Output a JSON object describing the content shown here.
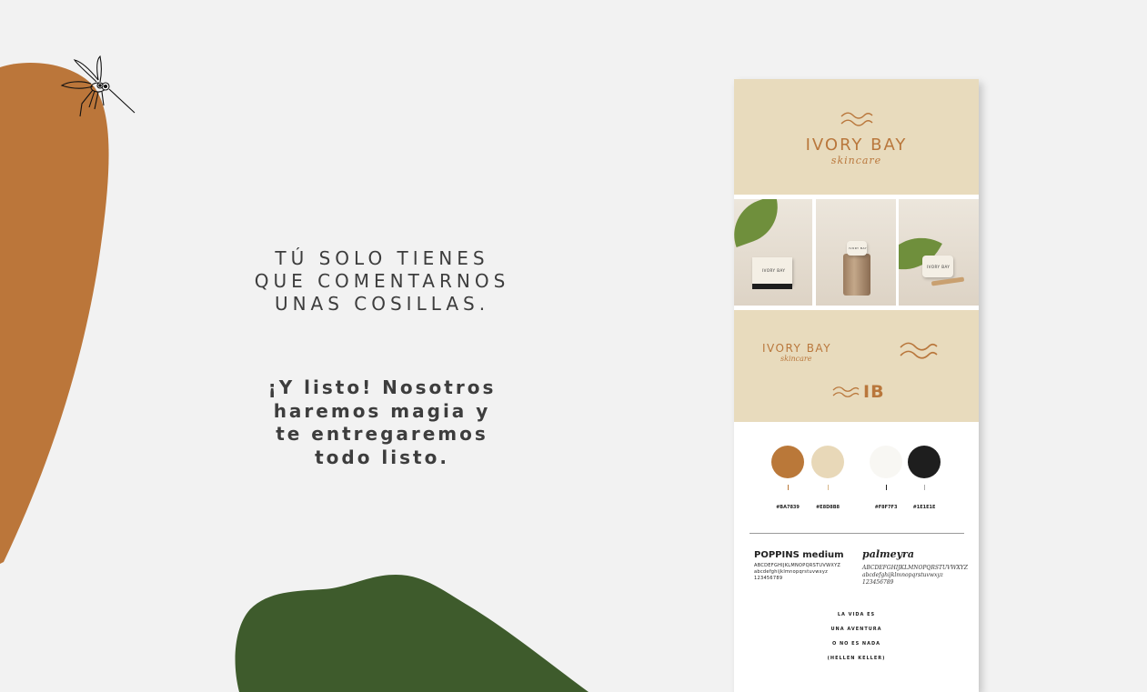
{
  "headline": {
    "lines": [
      "TÚ SOLO TIENES",
      "QUE COMENTARNOS",
      "UNAS COSILLAS."
    ]
  },
  "subtext": {
    "lines": [
      "¡Y listo! Nosotros",
      "haremos magia y",
      "te entregaremos",
      "todo listo."
    ]
  },
  "brand_board": {
    "brand_name": "IVORY BAY",
    "tagline": "skincare",
    "photo_labels": [
      "IVORY BAY",
      "IVORY BAY",
      "IVORY BAY"
    ],
    "monogram": "IB",
    "palette": [
      {
        "hex_label": "#BA7839",
        "color": "#ba7839"
      },
      {
        "hex_label": "#E8D8B8",
        "color": "#e8d8b8"
      },
      {
        "hex_label": "#F8F7F3",
        "color": "#f8f7f3"
      },
      {
        "hex_label": "#1E1E1E",
        "color": "#1e1e1e"
      }
    ],
    "fonts": {
      "primary_name": "POPPINS medium",
      "primary_upper": "ABCDEFGHIJKLMNOPQRSTUVWXYZ",
      "primary_lower": "abcdefghijklmnopqrstuvwxyz",
      "primary_digits": "123456789",
      "secondary_name": "palmeyra",
      "secondary_upper": "ABCDEFGHIJKLMNOPQRSTUVWXYZ",
      "secondary_lower": "abcdefghijklmnopqrstuvwxyz",
      "secondary_digits": "123456789"
    },
    "quote_lines": [
      "LA VIDA ES",
      "UNA AVENTURA",
      "O NO ES NADA",
      "(HELLEN KELLER)"
    ]
  },
  "colors": {
    "background": "#f2f2f2",
    "orange_shape": "#bb763a",
    "green_shape": "#3e5b2c",
    "beige": "#e8dbbd",
    "brand_text": "#b9773c"
  }
}
